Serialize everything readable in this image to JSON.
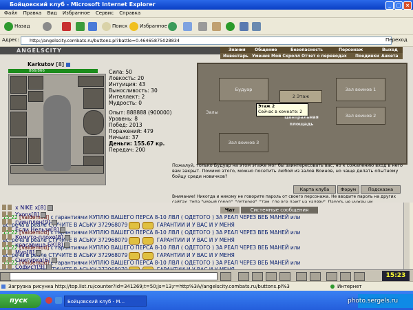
{
  "window": {
    "title": "Бойцовский клуб - Microsoft Internet Explorer"
  },
  "menu": [
    "Файл",
    "Правка",
    "Вид",
    "Избранное",
    "Сервис",
    "Справка"
  ],
  "toolbar": {
    "back_label": "Назад",
    "search_label": "Поиск",
    "favorites_label": "Избранное"
  },
  "address": {
    "label": "Адрес:",
    "url": "http://angelscity.combats.ru/buttons.pl?battle=0.46465875028834",
    "go_label": "Переход"
  },
  "game": {
    "logo": "ANGELSCITY",
    "nav_top": [
      "Знания",
      "Общение",
      "Безопасность",
      "Персонаж",
      "Выход"
    ],
    "nav_bottom": [
      "Инвентарь",
      "Умения",
      "Мой Скролл",
      "Отчет о переводах",
      "Поединки",
      "Анкета"
    ],
    "character": {
      "name": "Karkutov",
      "level": "[8]",
      "hp": "866/866"
    },
    "stats": [
      "Сила: 50",
      "Ловкость: 20",
      "Интуиция: 43",
      "Выносливость: 30",
      "Интеллект: 2",
      "Мудрость: 0"
    ],
    "stats2": [
      "Опыт: 888888 (900000)",
      "Уровень: 8",
      "Побед: 2013",
      "Поражений: 479",
      "Ничьих: 37",
      "Деньги: 155.67 кр.",
      "Передач: 200"
    ],
    "map": {
      "rooms": [
        "Будуар",
        "Зал воинов 1",
        "2 Этаж",
        "Залы",
        "Зал воинов 2",
        "Центральная площадь",
        "Зал воинов 3"
      ],
      "tooltip_line1": "Этаж 2",
      "tooltip_line2": "Сейчас в комнате: 2",
      "description": "Пожалуй, только Будуар на этом этаже мог бы заинтересовать вас, но к сожалению вход в него вам закрыт. Помимо этого, можно посетить любой из залов Воинов, но чаще делать опытному бойцу среди новичков?"
    },
    "tabs": [
      "Карта клуба",
      "Форум",
      "Подсказка"
    ],
    "warning": "Внимание! Никогда и никому не говорите пароль от своего персонажа. Не вводите пароль на других сайтах, типа \"новый город\", \"лотерея\", \"там, где все дают на халяву\". Пароль не нужен ни"
  },
  "chat": {
    "tabs": [
      "Чат",
      "Системные сообщения"
    ],
    "lines": [
      {
        "time": "15:22",
        "nick": "[Valdemod]",
        "text": "с гарантиями КУПЛЮ ВАШЕГО ПЕРСА 8-10 ЛВЛ ( ОДЕТОГО ) ЗА РЕАЛ ЧЕРЕЗ ВЕБ МАНЕЙ или"
      },
      {
        "time": "",
        "nick": "",
        "text": "встреча в реале СТУЧИТЕ В АСЬКУ 372968079",
        "tail": "ГАРАНТИИ И У ВАС И У МЕНЯ"
      },
      {
        "time": "15:22",
        "nick": "[Valdemod]",
        "text": "с гарантиями КУПЛЮ ВАШЕГО ПЕРСА 8-10 ЛВЛ ( ОДЕТОГО ) ЗА РЕАЛ ЧЕРЕЗ ВЕБ МАНЕЙ или"
      },
      {
        "time": "",
        "nick": "",
        "text": "встреча в реале СТУЧИТЕ В АСЬКУ 372968079",
        "tail": "ГАРАНТИИ И У ВАС И У МЕНЯ"
      },
      {
        "time": "15:22",
        "nick": "[Valdemod]",
        "text": "с гарантиями КУПЛЮ ВАШЕГО ПЕРСА 8-10 ЛВЛ ( ОДЕТОГО ) ЗА РЕАЛ ЧЕРЕЗ ВЕБ МАНЕЙ или"
      },
      {
        "time": "",
        "nick": "",
        "text": "встреча в реале СТУЧИТЕ В АСЬКУ 372968079",
        "tail": "ГАРАНТИИ И У ВАС И У МЕНЯ"
      },
      {
        "time": "15:22",
        "nick": "[Valdemod]",
        "text": "с гарантиями КУПЛЮ ВАШЕГО ПЕРСА 8-10 ЛВЛ ( ОДЕТОГО ) ЗА РЕАЛ ЧЕРЕЗ ВЕБ МАНЕЙ или"
      },
      {
        "time": "",
        "nick": "",
        "text": "встреча в реале СТУЧИТЕ В АСЬКУ 372968079",
        "tail": "ГАРАНТИИ И У ВАС И У МЕНЯ"
      }
    ]
  },
  "online": [
    "x NIKE x[8]",
    "Yxons[8]",
    "гуинплен[9]",
    "Если Нельзя[8]",
    "Комуто-плохо[8]",
    "красавица БК[8]",
    "Мур[8]",
    "Снигурка[6]",
    "Софист[9]"
  ],
  "clock": "15:23",
  "status": {
    "text": "Загрузка рисунка http://top.list.ru/counter?id=341269;t=50;js=13;r=http%3A//angelscity.combats.ru/buttons.pl%3",
    "zone": "Интернет"
  },
  "taskbar": {
    "start": "пуск",
    "item": "Бойцовский клуб - M..."
  },
  "watermark": "photo.sergels.ru"
}
